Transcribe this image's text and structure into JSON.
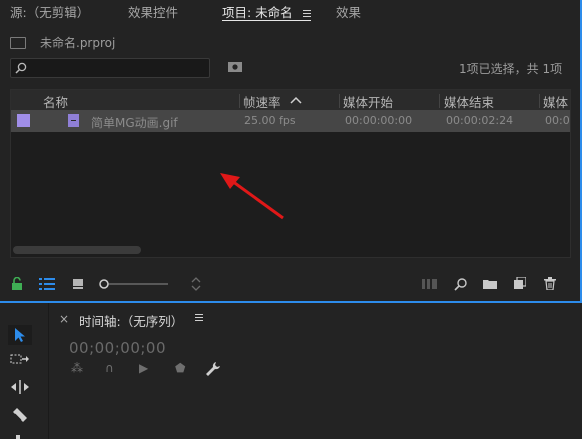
{
  "tabs": [
    {
      "label": "源:（无剪辑）"
    },
    {
      "label": "效果控件"
    },
    {
      "label": "项目: 未命名"
    },
    {
      "label": "效果"
    }
  ],
  "project": {
    "filename": "未命名.prproj",
    "selection_status": "1项已选择，共 1项",
    "columns": [
      "名称",
      "帧速率",
      "媒体开始",
      "媒体结束",
      "媒体"
    ],
    "rows": [
      {
        "name": "简单MG动画.gif",
        "frame_rate": "25.00 fps",
        "media_start": "00:00:00:00",
        "media_end": "00:00:02:24",
        "media_more": "00:0"
      }
    ],
    "label_color": "#a08ee8"
  },
  "timeline": {
    "title": "时间轴:（无序列）",
    "timecode": "00;00;00;00"
  },
  "colors": {
    "accent": "#2d8ceb",
    "annotation_arrow": "#e01818"
  },
  "icons": [
    "folder-icon",
    "search-icon",
    "new-bin-icon",
    "lock-icon",
    "list-view-icon",
    "icon-view-icon",
    "zoom-slider",
    "sort-icon",
    "freeform-view-icon",
    "find-icon",
    "new-folder-icon",
    "new-item-icon",
    "trash-icon",
    "selection-tool-icon",
    "track-select-icon",
    "ripple-edit-icon",
    "razor-icon",
    "wrench-icon"
  ]
}
